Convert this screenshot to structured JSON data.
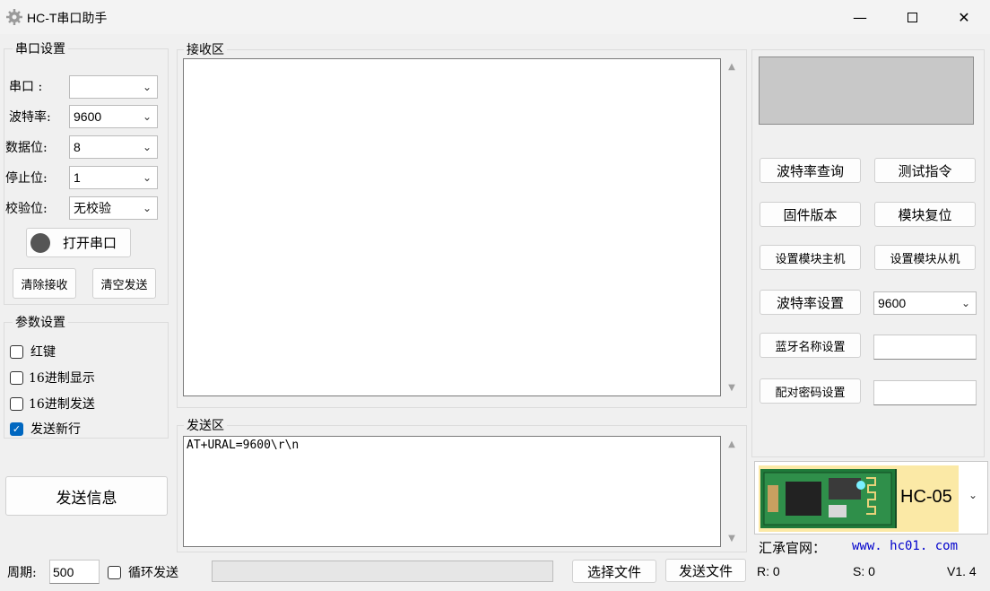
{
  "window": {
    "title": "HC-T串口助手",
    "minimize_icon": "minimize-icon",
    "maximize_icon": "maximize-icon",
    "close_icon": "close-icon"
  },
  "serial": {
    "group_label": "串口设置",
    "port_label": "串口  :",
    "port_value": "",
    "baud_label": "波特率:",
    "baud_value": "9600",
    "databits_label": "数据位:",
    "databits_value": "8",
    "stopbits_label": "停止位:",
    "stopbits_value": "1",
    "parity_label": "校验位:",
    "parity_value": "无校验",
    "open_button": "打开串口",
    "clear_receive": "清除接收",
    "clear_send": "清空发送"
  },
  "params": {
    "group_label": "参数设置",
    "red_key": "红键",
    "hex_display": "16进制显示",
    "hex_send": "16进制发送",
    "send_newline": "发送新行",
    "send_newline_checked": true
  },
  "send_info_button": "发送信息",
  "receive": {
    "label": "接收区",
    "content": ""
  },
  "send": {
    "label": "发送区",
    "content": "AT+URAL=9600\\r\\n"
  },
  "bottom": {
    "period_label": "周期:",
    "period_value": "500",
    "loop_send": "循环发送",
    "select_file": "选择文件",
    "send_file": "发送文件",
    "r_count": "R: 0",
    "s_count": "S: 0",
    "version": "V1. 4"
  },
  "right": {
    "baud_query": "波特率查询",
    "test_cmd": "测试指令",
    "firmware": "固件版本",
    "module_reset": "模块复位",
    "set_master": "设置模块主机",
    "set_slave": "设置模块从机",
    "baud_set": "波特率设置",
    "baud_set_value": "9600",
    "bt_name": "蓝牙名称设置",
    "bt_name_value": "",
    "pair_pwd": "配对密码设置",
    "pair_pwd_value": "",
    "module_model": "HC-05",
    "website_label": "汇承官网：",
    "website_url": "www. hc01. com"
  },
  "colors": {
    "link": "#0000cc",
    "module_label_bg": "#fbe9a6",
    "preview_box": "#c8c8c8",
    "check_on": "#0067c0"
  }
}
